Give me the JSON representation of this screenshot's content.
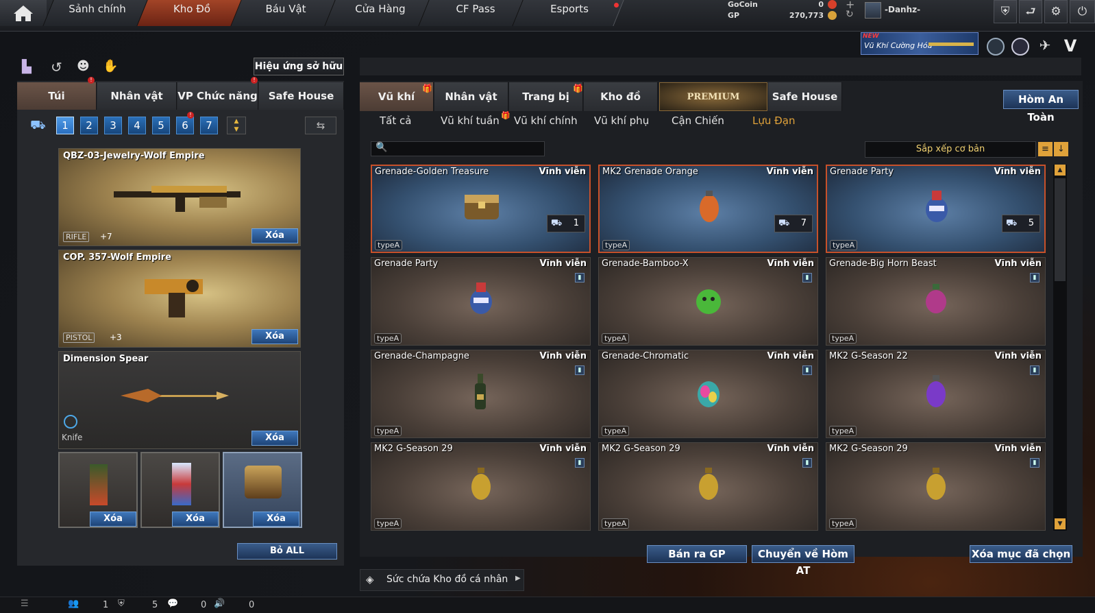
{
  "nav": {
    "tabs": [
      "Sảnh chính",
      "Kho Đồ",
      "Báu Vật",
      "Cửa Hàng",
      "CF Pass",
      "Esports"
    ],
    "active_index": 1
  },
  "currency": {
    "gocoin_label": "GoCoin",
    "gocoin_value": "0",
    "gp_label": "GP",
    "gp_value": "270,773"
  },
  "user": {
    "name": "-Danhz-"
  },
  "promo": {
    "new": "NEW",
    "text": "Vũ Khí Cường Hóa"
  },
  "left": {
    "effect_button": "Hiệu ứng sở hữu",
    "tabs": [
      "Túi",
      "Nhân vật",
      "VP Chức năng",
      "Safe House"
    ],
    "pages": [
      "1",
      "2",
      "3",
      "4",
      "5",
      "6",
      "7"
    ],
    "cards": [
      {
        "name": "QBZ-03-Jewelry-Wolf Empire",
        "type": "RIFLE",
        "ammo": "+7",
        "delete": "Xóa"
      },
      {
        "name": "COP. 357-Wolf Empire",
        "type": "PISTOL",
        "ammo": "+3",
        "delete": "Xóa"
      },
      {
        "name": "Dimension Spear",
        "type": "Knife",
        "ammo": "",
        "delete": "Xóa"
      }
    ],
    "small_delete": "Xóa",
    "remove_all": "Bỏ ALL"
  },
  "right": {
    "tabs": [
      "Vũ khí",
      "Nhân vật",
      "Trang bị",
      "Kho đồ",
      "PREMIUM",
      "Safe House"
    ],
    "safe_box": "Hòm An Toàn",
    "subtabs": [
      "Tất cả",
      "Vũ khí tuần",
      "Vũ khí chính",
      "Vũ khí phụ",
      "Cận Chiến",
      "Lựu Đạn"
    ],
    "active_subtab": 5,
    "search_placeholder": "",
    "sort_label": "Sắp xếp cơ bản",
    "items": [
      {
        "name": "Grenade-Golden Treasure",
        "perm": "Vĩnh viễn",
        "type": "typeA",
        "count": "1",
        "selected": true,
        "icon": "chest"
      },
      {
        "name": "MK2 Grenade Orange",
        "perm": "Vĩnh viễn",
        "type": "typeA",
        "count": "7",
        "selected": true,
        "icon": "orange"
      },
      {
        "name": "Grenade Party",
        "perm": "Vĩnh viễn",
        "type": "typeA",
        "count": "5",
        "selected": true,
        "icon": "party"
      },
      {
        "name": "Grenade Party",
        "perm": "Vĩnh viễn",
        "type": "typeA",
        "count": "",
        "selected": false,
        "icon": "party"
      },
      {
        "name": "Grenade-Bamboo-X",
        "perm": "Vĩnh viễn",
        "type": "typeA",
        "count": "",
        "selected": false,
        "icon": "bamboo"
      },
      {
        "name": "Grenade-Big Horn Beast",
        "perm": "Vĩnh viễn",
        "type": "typeA",
        "count": "",
        "selected": false,
        "icon": "beast"
      },
      {
        "name": "Grenade-Champagne",
        "perm": "Vĩnh viễn",
        "type": "typeA",
        "count": "",
        "selected": false,
        "icon": "bottle"
      },
      {
        "name": "Grenade-Chromatic",
        "perm": "Vĩnh viễn",
        "type": "typeA",
        "count": "",
        "selected": false,
        "icon": "chromatic"
      },
      {
        "name": "MK2 G-Season 22",
        "perm": "Vĩnh viễn",
        "type": "typeA",
        "count": "",
        "selected": false,
        "icon": "purple"
      },
      {
        "name": "MK2 G-Season 29",
        "perm": "Vĩnh viễn",
        "type": "typeA",
        "count": "",
        "selected": false,
        "icon": "gold"
      },
      {
        "name": "MK2 G-Season 29",
        "perm": "Vĩnh viễn",
        "type": "typeA",
        "count": "",
        "selected": false,
        "icon": "gold"
      },
      {
        "name": "MK2 G-Season 29",
        "perm": "Vĩnh viễn",
        "type": "typeA",
        "count": "",
        "selected": false,
        "icon": "gold"
      }
    ],
    "sell_button": "Bán ra GP",
    "move_button": "Chuyển về Hòm AT",
    "delete_selected": "Xóa mục đã chọn",
    "capacity_label": "Sức chứa Kho đồ cá nhân"
  },
  "status": {
    "friends": "1",
    "clan": "5",
    "chat": "0",
    "voice": "0"
  },
  "colors": {
    "accent": "#c8512a",
    "active_nav": "#a24427",
    "button_blue": "#2a6fb8",
    "subtab_active": "#e0a23a"
  }
}
